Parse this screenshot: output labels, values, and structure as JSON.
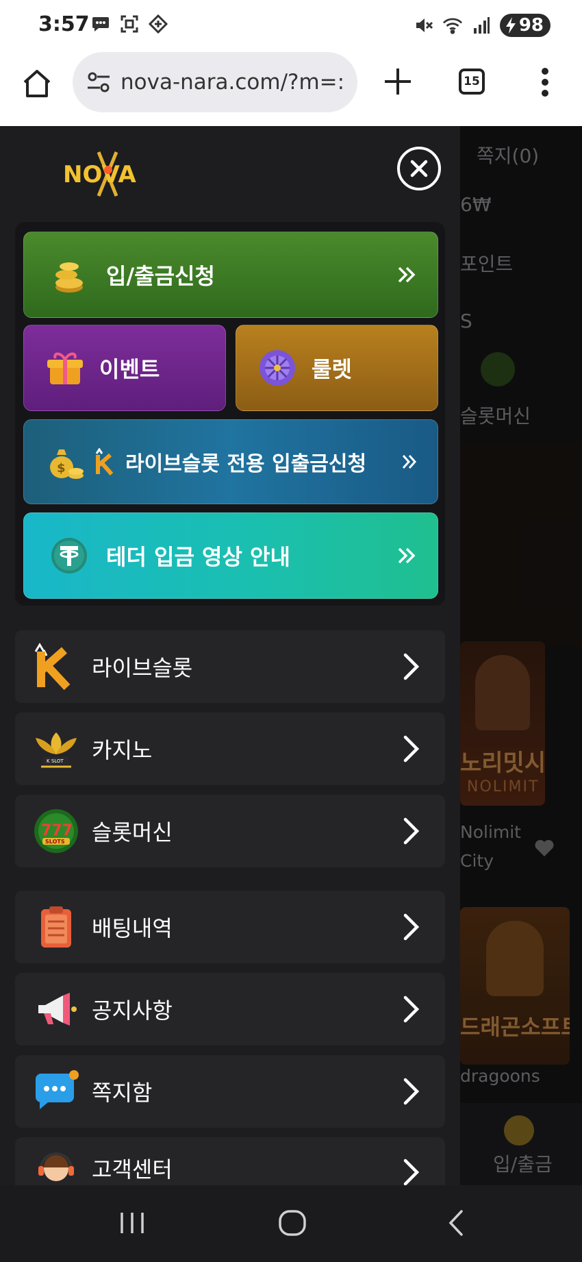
{
  "status_bar": {
    "time": "3:57",
    "battery": "98",
    "icons": [
      "chat-icon",
      "screenshot-icon",
      "diamond-icon",
      "mute-icon",
      "wifi-icon",
      "signal-icon",
      "charging-icon"
    ]
  },
  "browser": {
    "url": "nova-nara.com/?m=:",
    "tab_count": "15"
  },
  "background_page": {
    "notes": "쪽지(0)",
    "balance_fragment": "6₩",
    "point_fragment": "포인트",
    "s_fragment": "S",
    "slot_label": "슬롯머신",
    "card1_title": "노리밋시티",
    "card1_brand": "NOLIMIT",
    "card1_name_line1": "Nolimit",
    "card1_name_line2": "City",
    "card2_title": "드래곤소프트",
    "card2_name": "dragoons",
    "bottom_nav_label": "입/출금"
  },
  "drawer": {
    "logo_text": "NOVA",
    "quick": {
      "deposit_label": "입/출금신청",
      "event_label": "이벤트",
      "roulette_label": "룰렛",
      "live_label": "라이브슬롯 전용 입출금신청",
      "tether_label": "테더 입금 영상 안내"
    },
    "menu": [
      {
        "label": "라이브슬롯",
        "icon": "live-slot-k-icon"
      },
      {
        "label": "카지노",
        "icon": "kslot-casino-icon"
      },
      {
        "label": "슬롯머신",
        "icon": "777-slots-icon"
      },
      {
        "label": "배팅내역",
        "icon": "clipboard-icon"
      },
      {
        "label": "공지사항",
        "icon": "megaphone-icon"
      },
      {
        "label": "쪽지함",
        "icon": "chat-bubble-icon"
      },
      {
        "label": "고객센터",
        "icon": "support-agent-icon"
      }
    ],
    "colors": {
      "deposit": "#3f7d27",
      "event": "#6f2590",
      "roulette": "#a8741a",
      "live": "#1e6a92",
      "tether": "#1bbcb0"
    }
  }
}
